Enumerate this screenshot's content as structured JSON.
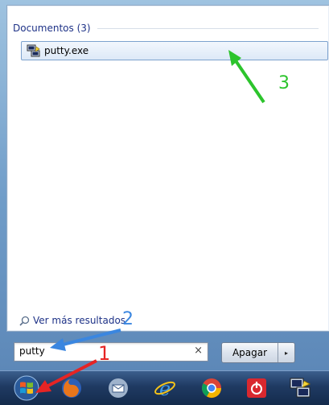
{
  "results": {
    "group_header": "Documentos (3)",
    "items": [
      {
        "label": "putty.exe",
        "icon": "putty-icon"
      }
    ],
    "more_results": "Ver más resultados"
  },
  "search": {
    "value": "putty",
    "clear_glyph": "×"
  },
  "shutdown": {
    "label": "Apagar",
    "arrow_glyph": "▸"
  },
  "annotations": {
    "step1": "1",
    "step2": "2",
    "step3": "3",
    "colors": {
      "step1": "#e62424",
      "step2": "#3a86e0",
      "step3": "#2cc42c"
    }
  },
  "taskbar": {
    "icons": [
      "windows-start-icon",
      "firefox-icon",
      "thunderbird-icon",
      "internet-explorer-icon",
      "chrome-icon",
      "power-app-icon",
      "putty-taskbar-icon"
    ]
  }
}
